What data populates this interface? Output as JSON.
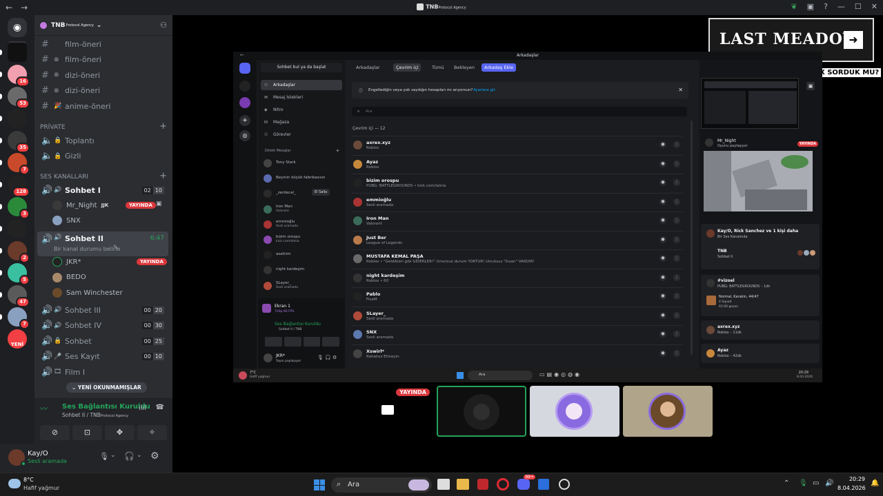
{
  "titlebar": {
    "back": "←",
    "forward": "→",
    "title": "TNB",
    "title_sub": "Protocol Agency"
  },
  "servers": {
    "badges": [
      "",
      "16",
      "53",
      "",
      "35",
      "7",
      "128",
      "3",
      "",
      "2",
      "5",
      "47",
      "7",
      "YENİ"
    ]
  },
  "guild": {
    "name": "TNB",
    "name_sub": "Protocol Agency"
  },
  "text_channels": [
    {
      "emoji": "",
      "name": "film-öneri"
    },
    {
      "emoji": "⊗",
      "name": "film-öneri"
    },
    {
      "emoji": "⊗",
      "name": "dizi-öneri"
    },
    {
      "emoji": "⊗",
      "name": "dizi-öneri"
    },
    {
      "emoji": "🎉",
      "name": "anime-öneri"
    }
  ],
  "private_cat": "PRİVATE",
  "private_channels": [
    {
      "name": "Toplantı"
    },
    {
      "name": "Gizli"
    }
  ],
  "voice_cat": "SES KANALLARI",
  "sohbet1": {
    "name": "Sohbet I",
    "c1": "02",
    "c2": "10"
  },
  "sohbet1_users": [
    {
      "name": "Mr_Night",
      "tag": "JJK",
      "live": "YAYINDA"
    },
    {
      "name": "SNX"
    }
  ],
  "sohbet2": {
    "name": "Sohbet II",
    "time": "6:47",
    "status": "Bir kanal durumu belirle"
  },
  "sohbet2_users": [
    {
      "name": "JKR*",
      "live": "YAYINDA"
    },
    {
      "name": "BEDO"
    },
    {
      "name": "Sam Winchester"
    }
  ],
  "other_voice": [
    {
      "name": "Sohbet III",
      "c1": "00",
      "c2": "20"
    },
    {
      "name": "Sohbet IV",
      "c1": "00",
      "c2": "30"
    },
    {
      "name": "Sohbet",
      "c1": "00",
      "c2": "25"
    },
    {
      "name": "Ses Kayıt",
      "c1": "00",
      "c2": "10"
    },
    {
      "name": "Film I"
    }
  ],
  "unread_pill": "YENİ OKUNMAMIŞLAR",
  "voice_panel": {
    "title": "Ses Bağlantısı Kuruldu",
    "sub": "Sohbet II / TNB",
    "sub_small": "Protocol Agency"
  },
  "user_panel": {
    "name": "Kay/O",
    "status": "Sesli aramada"
  },
  "taskbar": {
    "temp": "8°C",
    "weather": "Hafif yağmur",
    "search": "Ara",
    "time": "20:29",
    "date": "8.04.2026",
    "badge": "99+"
  },
  "overlay": {
    "brand": "LAST MEADOW",
    "question": "X SORDUK MU?"
  },
  "tiles": {
    "live": "YAYINDA"
  },
  "inner": {
    "title": "Arkadaşlar",
    "search_btn": "Sohbet bul ya da başlat",
    "nav": [
      "Arkadaşlar",
      "Mesaj İstekleri",
      "Nitro",
      "Mağaza",
      "Görevler"
    ],
    "dm_header": "Direkt Mesajlar",
    "dms": [
      {
        "name": "Tony Stark",
        "sub": ""
      },
      {
        "name": "Beyinin küçük fabrikasısın",
        "sub": ""
      },
      {
        "name": "_zerdecal_",
        "sub": "",
        "extra": "El Salla"
      },
      {
        "name": "Iron Man",
        "sub": "Valorant"
      },
      {
        "name": "emmioğlu",
        "sub": "Sesli aramada"
      },
      {
        "name": "bizim orospu",
        "sub": "kick.com/lalnia"
      },
      {
        "name": "asafcim",
        "sub": ""
      },
      {
        "name": "night kardeşim",
        "sub": ""
      },
      {
        "name": "SLayer_",
        "sub": "Sesli aramada"
      }
    ],
    "stream": {
      "name": "Ekran 1",
      "sub": "720p 60 FPS"
    },
    "conn": {
      "title": "Ses Bağlantısı Kuruldu",
      "sub": "Sohbet II / TNB"
    },
    "me": {
      "name": "JKR*",
      "sub": "Yayın paylaşıyor"
    },
    "tabs": [
      "Arkadaşlar",
      "Çevrim içi",
      "Tümü",
      "Bekleyen",
      "Arkadaş Ekle"
    ],
    "notice": "Engellediğin veya yok saydığın hesapları mı arıyorsun?",
    "notice_link": "Ayarlara git",
    "search": "Ara",
    "online": "Çevrim içi — 12",
    "friends": [
      {
        "name": "axrex.xyz",
        "status": "Roblox",
        "color": "#6b4a3a"
      },
      {
        "name": "Ayaz",
        "status": "Roblox",
        "color": "#c8883c"
      },
      {
        "name": "bizim orospu",
        "status": "PUBG: BATTLEGROUNDS • kick.com/lalnia",
        "color": "#222"
      },
      {
        "name": "emmioğlu",
        "status": "Sesli aramada",
        "color": "#a33"
      },
      {
        "name": "Iron Man",
        "status": "Valorant",
        "color": "#3a6b5a"
      },
      {
        "name": "Just Ber",
        "status": "League of Legends",
        "color": "#b97a4a"
      },
      {
        "name": "MUSTAFA KEMAL PAŞA",
        "status": "Roblox • \"Geldikleri gibi GİDERLER!\" Umutsuz durum YOKTUR! Umutsuz \"İnsan\" VARDIR!",
        "color": "#6a6a6a"
      },
      {
        "name": "night kardeşim",
        "status": "Roblox • 60",
        "color": "#333"
      },
      {
        "name": "Pablo",
        "status": "FiveM",
        "color": "#222"
      },
      {
        "name": "SLayer_",
        "status": "Sesli aramada",
        "color": "#b04a3a"
      },
      {
        "name": "SNX",
        "status": "Sesli aramada",
        "color": "#5a7ab0"
      },
      {
        "name": "Xswirl*",
        "status": "Rahatsız Etmeyin",
        "color": "#444"
      }
    ],
    "right": {
      "stream_user": "Mr_Night",
      "stream_sub": "Oyunu paylaşıyor",
      "live": "YAYINDA",
      "voice_title": "Kay/O, Rick Sanchez ve 1 kişi daha",
      "voice_sub": "Bir Ses Kanalında",
      "voice_guild": "TNB",
      "voice_ch": "Sohbet II",
      "game_title": "#vizoel",
      "game_sub": "PUBG: BATTLEGROUNDS – 1dk",
      "game_mode": "Normal, Karakin, 44/47",
      "game_squad": "4 Squad",
      "game_time": "01:00 geçen",
      "a1": "axrex.xyz",
      "a1s": "Roblox – 11dk",
      "a2": "Ayaz",
      "a2s": "Roblox – 42dk"
    },
    "taskbar": {
      "temp": "7°C",
      "weather": "Hafif yağmur",
      "search": "Ara",
      "time": "20:29",
      "date": "8.04.2026"
    }
  }
}
